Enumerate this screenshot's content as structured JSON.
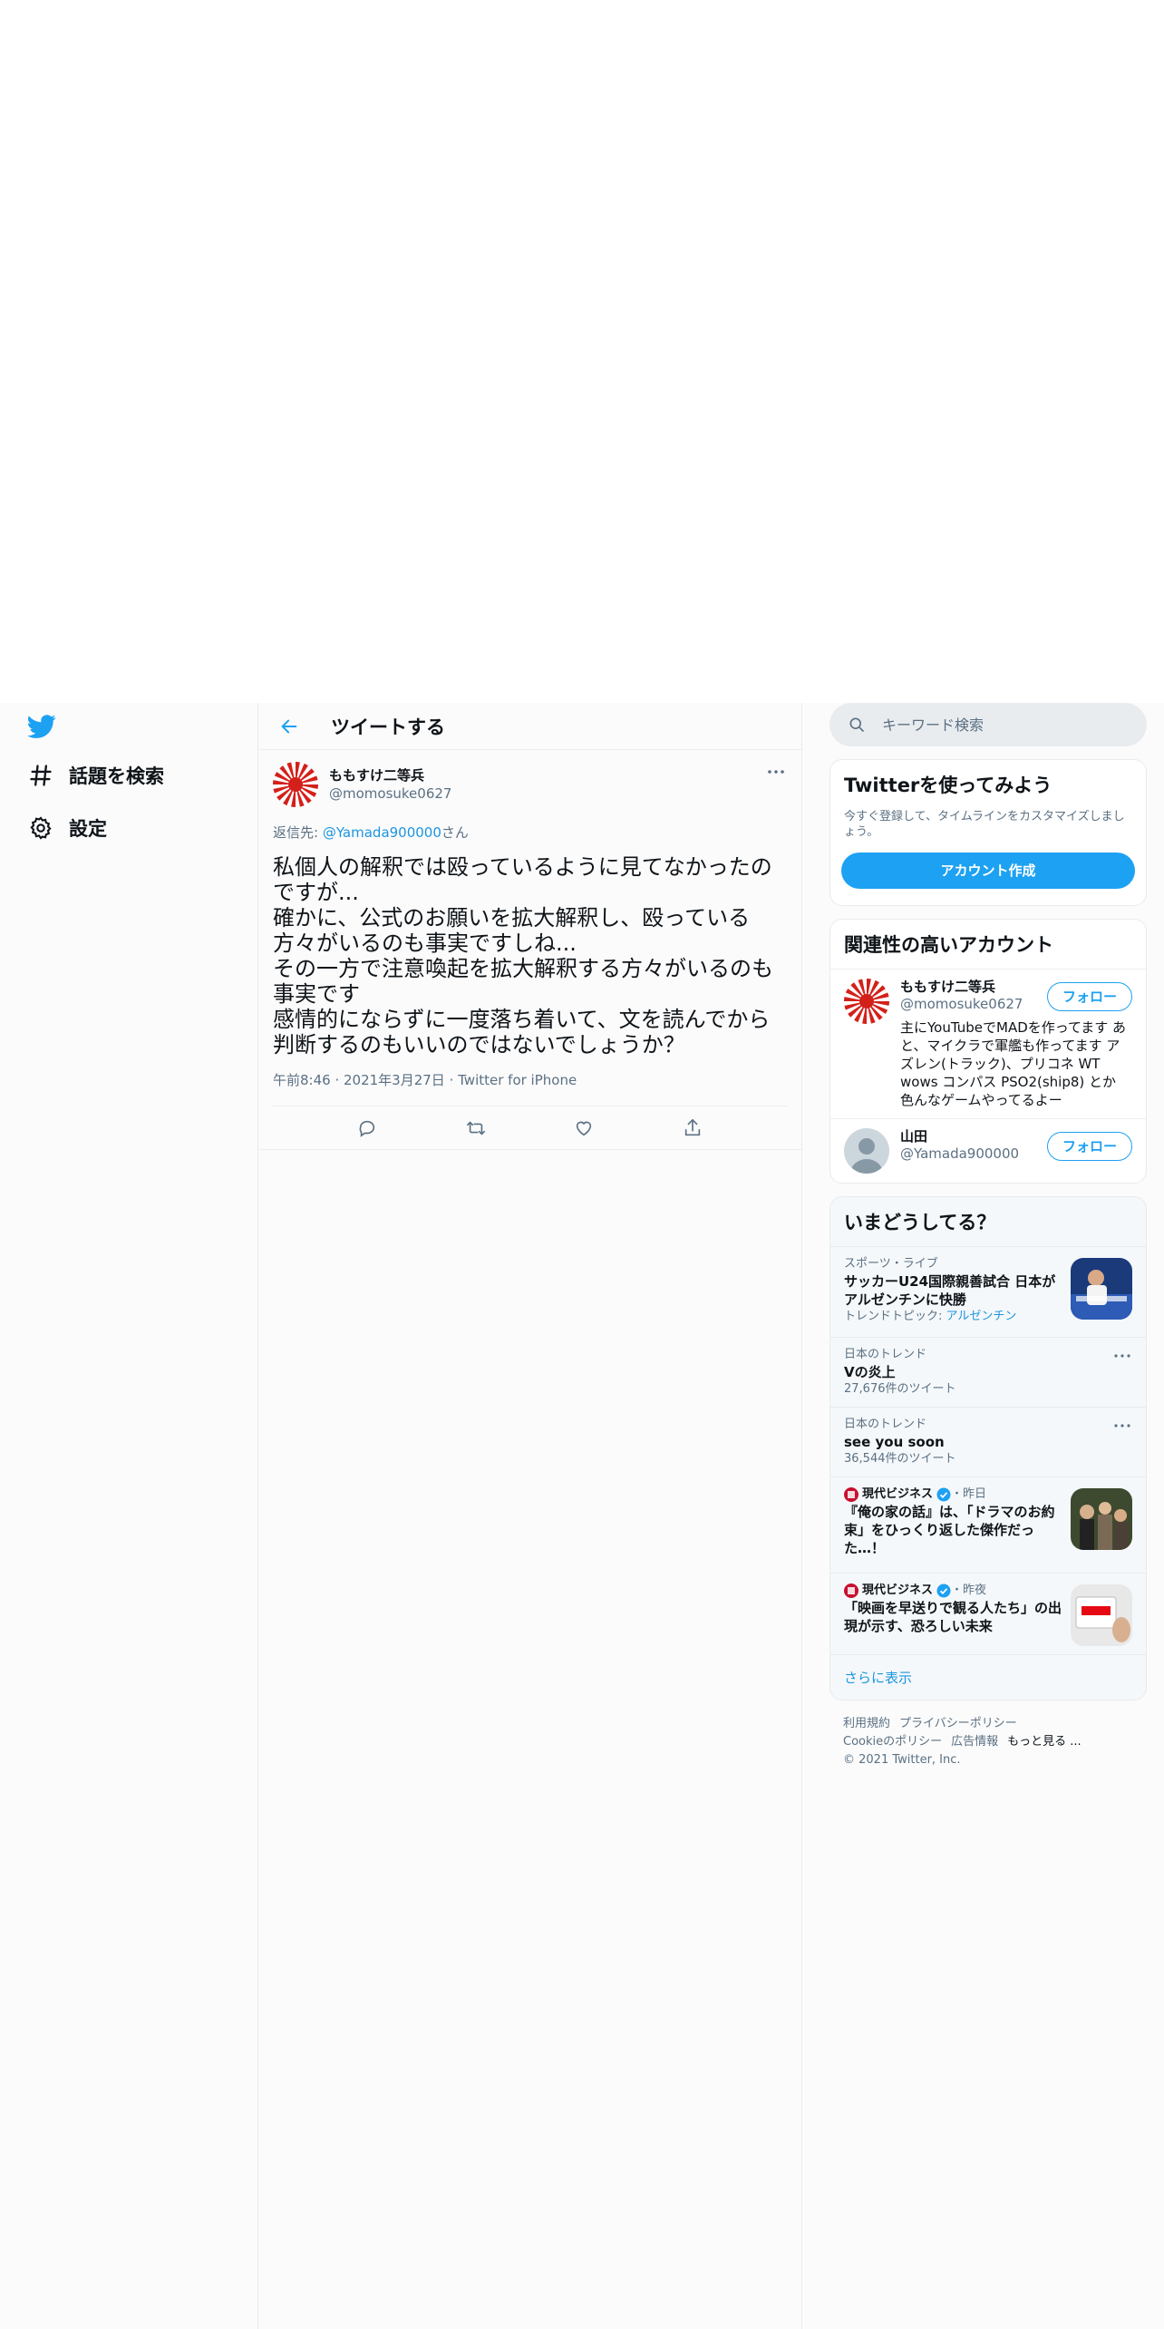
{
  "nav": {
    "items": [
      {
        "label": "話題を検索",
        "icon": "hashtag-icon"
      },
      {
        "label": "設定",
        "icon": "gear-icon"
      }
    ]
  },
  "header": {
    "title": "ツイートする"
  },
  "tweet": {
    "user_name": "ももすけ二等兵",
    "user_handle": "@momosuke0627",
    "reply_prefix": "返信先: ",
    "reply_handle": "@Yamada900000",
    "reply_suffix": "さん",
    "body": "私個人の解釈では殴っているように見てなかったのですが...\n確かに、公式のお願いを拡大解釈し、殴っている方々がいるのも事実ですしね...\nその一方で注意喚起を拡大解釈する方々がいるのも事実です\n感情的にならずに一度落ち着いて、文を読んでから判断するのもいいのではないでしょうか？",
    "time": "午前8:46",
    "date": "2021年3月27日",
    "source": "Twitter for iPhone"
  },
  "search": {
    "placeholder": "キーワード検索"
  },
  "signup": {
    "title": "Twitterを使ってみよう",
    "desc": "今すぐ登録して、タイムラインをカスタマイズしましょう。",
    "button": "アカウント作成"
  },
  "related": {
    "title": "関連性の高いアカウント",
    "accounts": [
      {
        "name": "ももすけ二等兵",
        "handle": "@momosuke0627",
        "bio": "主にYouTubeでMADを作ってます あと、マイクラで軍艦も作ってます アズレン(トラック)、プリコネ WT wows コンパス PSO2(ship8) とか色んなゲームやってるよー",
        "follow": "フォロー"
      },
      {
        "name": "山田",
        "handle": "@Yamada900000",
        "bio": "",
        "follow": "フォロー"
      }
    ]
  },
  "trends": {
    "title": "いまどうしてる？",
    "items": [
      {
        "category": "スポーツ・ライブ",
        "title": "サッカーU24国際親善試合 日本がアルゼンチンに快勝",
        "topic_prefix": "トレンドトピック: ",
        "topic": "アルゼンチン"
      },
      {
        "category": "日本のトレンド",
        "title": "Vの炎上",
        "count": "27,676件のツイート"
      },
      {
        "category": "日本のトレンド",
        "title": "see you soon",
        "count": "36,544件のツイート"
      },
      {
        "source": "現代ビジネス",
        "when": "・昨日",
        "title": "『俺の家の話』は、「ドラマのお約束」をひっくり返した傑作だった…！"
      },
      {
        "source": "現代ビジネス",
        "when": "・昨夜",
        "title": "「映画を早送りで観る人たち」の出現が示す、恐ろしい未来"
      }
    ],
    "show_more": "さらに表示"
  },
  "footer": {
    "links": [
      "利用規約",
      "プライバシーポリシー",
      "Cookieのポリシー",
      "広告情報",
      "もっと見る ..."
    ],
    "copyright": "© 2021 Twitter, Inc."
  },
  "colors": {
    "accent": "#1da1f2",
    "link": "#1b95e0",
    "secondary_text": "#5b7083"
  }
}
